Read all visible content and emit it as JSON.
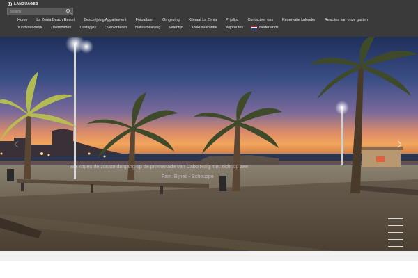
{
  "header": {
    "languages_label": "LANGUAGES",
    "search_placeholder": "search"
  },
  "nav": {
    "row1": [
      "Home",
      "La Zenia Beach Resort",
      "Beschrijving Appartement",
      "Fotoalbum",
      "Omgeving",
      "Klimaat La Zenia",
      "Prijslijst",
      "Contacteer ons",
      "Reservatie kalender",
      "Reacties van onze gasten"
    ],
    "row2": [
      "Kindvriendelijk",
      "Zwembaden",
      "Uitstapjes",
      "Overwinteren",
      "Natuurbeleving",
      "Valentijn",
      "Krokusvakantie",
      "Wijnroutes"
    ],
    "language": "Nederlands"
  },
  "hero": {
    "caption": "We kopen de zonsondergang op de promenade van Cabo Roig met zicht op zee",
    "credit": "Fam. Bijnes - Schouppe"
  },
  "colors": {
    "header_bg": "#3a3a3a",
    "nav_text": "#e9e9e9",
    "flag": [
      "#ae1c28",
      "#ffffff",
      "#21468b"
    ]
  },
  "icons": {
    "globe": "globe-icon",
    "search": "search-icon",
    "flag": "netherlands-flag-icon",
    "next": "chevron-right-icon",
    "prev": "chevron-left-icon",
    "menu": "slider-menu-icon"
  }
}
